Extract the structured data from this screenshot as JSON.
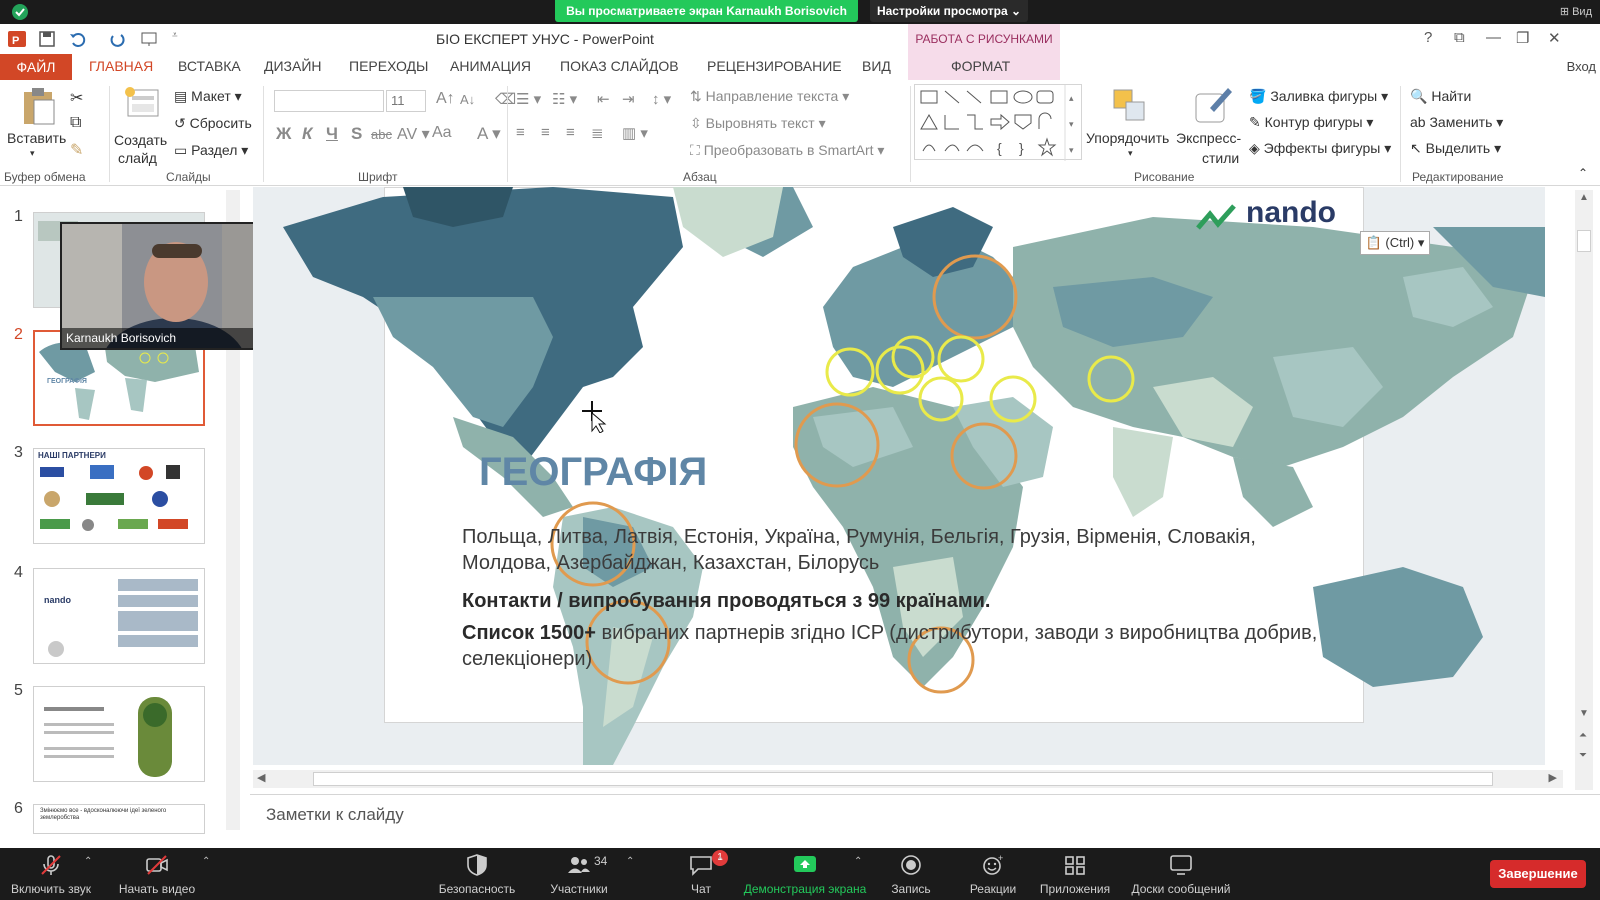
{
  "zoom": {
    "share_banner": "Вы просматриваете экран Karnaukh Borisovich",
    "view_options": "Настройки просмотра",
    "view_label": "Вид",
    "participant_name": "Karnaukh Borisovich",
    "participants_count": "34",
    "chat_badge": "1",
    "toolbar": [
      {
        "label": "Включить звук",
        "icon": "mic-muted-icon"
      },
      {
        "label": "Начать видео",
        "icon": "video-off-icon"
      },
      {
        "label": "Безопасность",
        "icon": "shield-icon"
      },
      {
        "label": "Участники",
        "icon": "participants-icon"
      },
      {
        "label": "Чат",
        "icon": "chat-icon"
      },
      {
        "label": "Демонстрация экрана",
        "icon": "share-screen-icon"
      },
      {
        "label": "Запись",
        "icon": "record-icon"
      },
      {
        "label": "Реакции",
        "icon": "reactions-icon"
      },
      {
        "label": "Приложения",
        "icon": "apps-icon"
      },
      {
        "label": "Доски сообщений",
        "icon": "whiteboard-icon"
      }
    ],
    "end_button": "Завершение",
    "accent_green": "#23c95b",
    "end_red": "#d62b2b"
  },
  "ppt": {
    "window_title": "БІО ЕКСПЕРТ УНУС - PowerPoint",
    "context_header": "РАБОТА С РИСУНКАМИ",
    "tabs": {
      "file": "ФАЙЛ",
      "home": "ГЛАВНАЯ",
      "insert": "ВСТАВКА",
      "design": "ДИЗАЙН",
      "transitions": "ПЕРЕХОДЫ",
      "animations": "АНИМАЦИЯ",
      "slideshow": "ПОКАЗ СЛАЙДОВ",
      "review": "РЕЦЕНЗИРОВАНИЕ",
      "view": "ВИД",
      "format": "ФОРМАТ",
      "signin": "Вход"
    },
    "ribbon": {
      "paste": "Вставить",
      "create_slide_1": "Создать",
      "create_slide_2": "слайд",
      "layout": "Макет",
      "reset": "Сбросить",
      "section": "Раздел",
      "font_size": "11",
      "text_direction": "Направление текста",
      "align_text": "Выровнять текст",
      "smartart": "Преобразовать в SmartArt",
      "arrange": "Упорядочить",
      "quick_styles_1": "Экспресс-",
      "quick_styles_2": "стили",
      "shape_fill": "Заливка фигуры",
      "shape_outline": "Контур фигуры",
      "shape_effects": "Эффекты фигуры",
      "find": "Найти",
      "replace": "Заменить",
      "select": "Выделить",
      "groups": {
        "clipboard": "Буфер обмена",
        "slides": "Слайды",
        "font": "Шрифт",
        "paragraph": "Абзац",
        "drawing": "Рисование",
        "editing": "Редактирование"
      },
      "font_buttons": {
        "bold": "Ж",
        "italic": "К",
        "underline": "Ч",
        "shadow": "S",
        "strike": "abc",
        "case": "Aa"
      }
    },
    "thumbnails": [
      {
        "num": "1"
      },
      {
        "num": "2",
        "title": "ГЕОГРАФІЯ"
      },
      {
        "num": "3",
        "title": "НАШІ ПАРТНЕРИ"
      },
      {
        "num": "4"
      },
      {
        "num": "5"
      },
      {
        "num": "6",
        "title": "Змінюємо все - вдосконалюючи ідеї зеленого землеробства"
      }
    ],
    "notes_placeholder": "Заметки к слайду",
    "paste_options": "(Ctrl)"
  },
  "slide": {
    "title": "ГЕОГРАФІЯ",
    "logo": "nando",
    "countries": "Польща, Литва, Латвія, Естонія, Україна, Румунія, Бельгія, Грузія, Вірменія, Словакія, Молдова, Азербайджан, Казахстан, Білорусь",
    "contacts": "Контакти / випробування проводяться з 99 країнами.",
    "list_bold": "Список 1500+",
    "list_rest": "вибраних партнерів згідно ICP (дистрибутори, заводи з виробництва добрив, селекціонери)",
    "map_colors": {
      "dark": "#3f6b80",
      "mid": "#6f9aa3",
      "light": "#a7c6c2",
      "pale": "#c9dccf"
    },
    "circle_colors": {
      "orange": "#e09a4f",
      "yellow": "#e9ea4a"
    }
  }
}
